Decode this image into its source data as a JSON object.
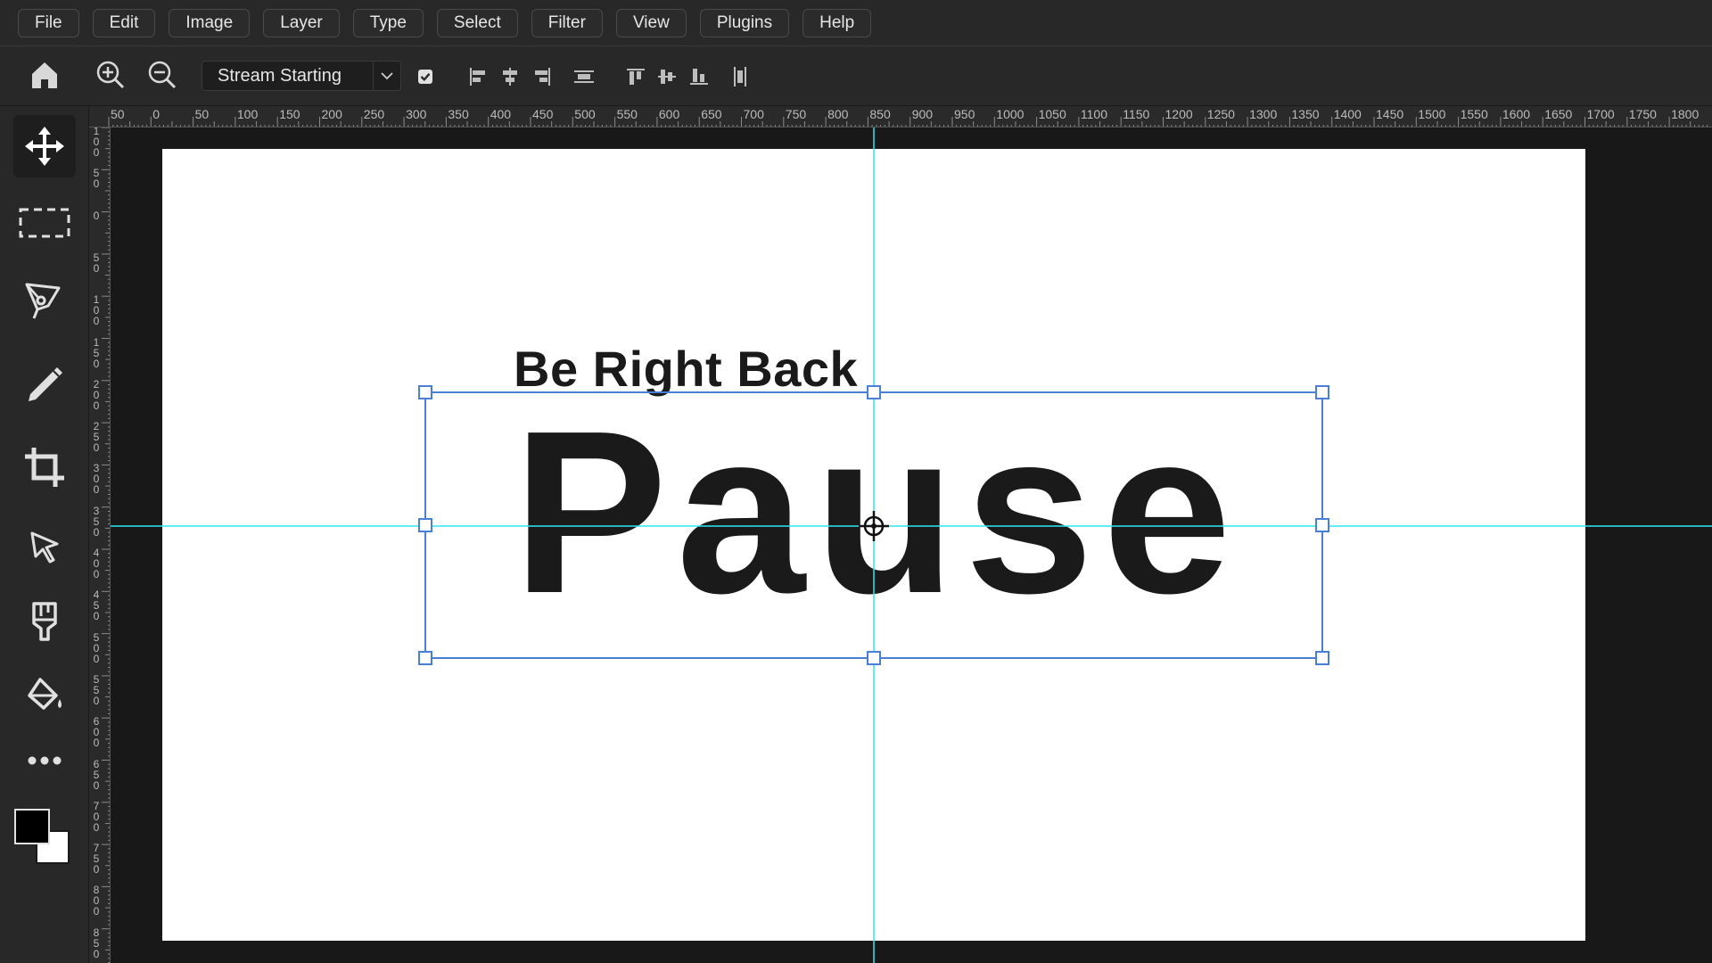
{
  "menubar": {
    "items": [
      {
        "label": "File"
      },
      {
        "label": "Edit"
      },
      {
        "label": "Image"
      },
      {
        "label": "Layer"
      },
      {
        "label": "Type"
      },
      {
        "label": "Select"
      },
      {
        "label": "Filter"
      },
      {
        "label": "View"
      },
      {
        "label": "Plugins"
      },
      {
        "label": "Help"
      }
    ]
  },
  "optionsbar": {
    "layer_select": "Stream Starting",
    "auto_select_checked": true
  },
  "ruler": {
    "top_labels": [
      "50",
      "0",
      "50",
      "100",
      "150",
      "200",
      "250",
      "300",
      "350",
      "400",
      "450",
      "500",
      "550",
      "600",
      "650",
      "700",
      "750",
      "800",
      "850",
      "900",
      "950",
      "1000",
      "1050",
      "1100",
      "1150",
      "1200",
      "1250",
      "1300",
      "1350",
      "1400",
      "1450",
      "1500",
      "1550",
      "1600",
      "1650",
      "1700",
      "1750",
      "1800"
    ],
    "left_labels": [
      "100",
      "50",
      "0",
      "50",
      "100",
      "150",
      "200",
      "250",
      "300",
      "350",
      "400",
      "450",
      "500",
      "550",
      "600",
      "650",
      "700",
      "750",
      "800",
      "850"
    ]
  },
  "canvas": {
    "subtitle": "Be Right Back",
    "title": "Pause"
  },
  "colors": {
    "foreground": "#000000",
    "background": "#ffffff",
    "guide": "#2ee6f0",
    "selection": "#4a7fd6"
  },
  "icons": {
    "tools": [
      "home-icon",
      "zoom-in-icon",
      "zoom-out-icon",
      "move-icon",
      "marquee-icon",
      "pen-tool-icon",
      "brush-icon",
      "crop-icon",
      "direct-select-icon",
      "stamp-icon",
      "paint-bucket-icon",
      "more-icon"
    ]
  }
}
